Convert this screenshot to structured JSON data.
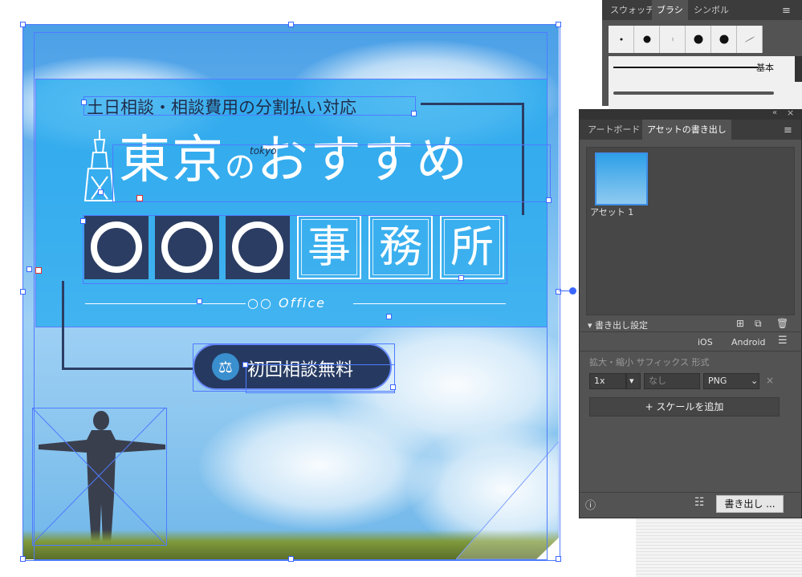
{
  "artwork": {
    "subtitle": "土日相談・相談費用の分割払い対応",
    "title_part1": "東京",
    "title_no": "の",
    "title_part2": "おすすめ",
    "tokyo_script": "tokyo",
    "kanji_boxes": [
      "事",
      "務",
      "所"
    ],
    "office_text": "○○ Office",
    "cta_label": "初回相談無料",
    "cta_icon": "scales-icon"
  },
  "brush_panel": {
    "tabs": [
      "スウォッチ",
      "ブラシ",
      "シンボル"
    ],
    "active_tab": "ブラシ",
    "basic_label": "基本"
  },
  "asset_export_panel": {
    "tabs": [
      "アートボード",
      "アセットの書き出し"
    ],
    "active_tab": "アセットの書き出し",
    "asset_name": "アセット 1",
    "export_settings_label": "書き出し設定",
    "platforms": [
      "iOS",
      "Android"
    ],
    "column_headers": "拡大・縮小  サフィックス  形式",
    "scale_value": "1x",
    "suffix_placeholder": "なし",
    "format_value": "PNG",
    "add_scale_label": "+ スケールを追加",
    "export_button_label": "書き出し ..."
  },
  "colors": {
    "accent_blue": "#3a66ff",
    "panel_bg": "#535353",
    "navy": "#263a61"
  }
}
